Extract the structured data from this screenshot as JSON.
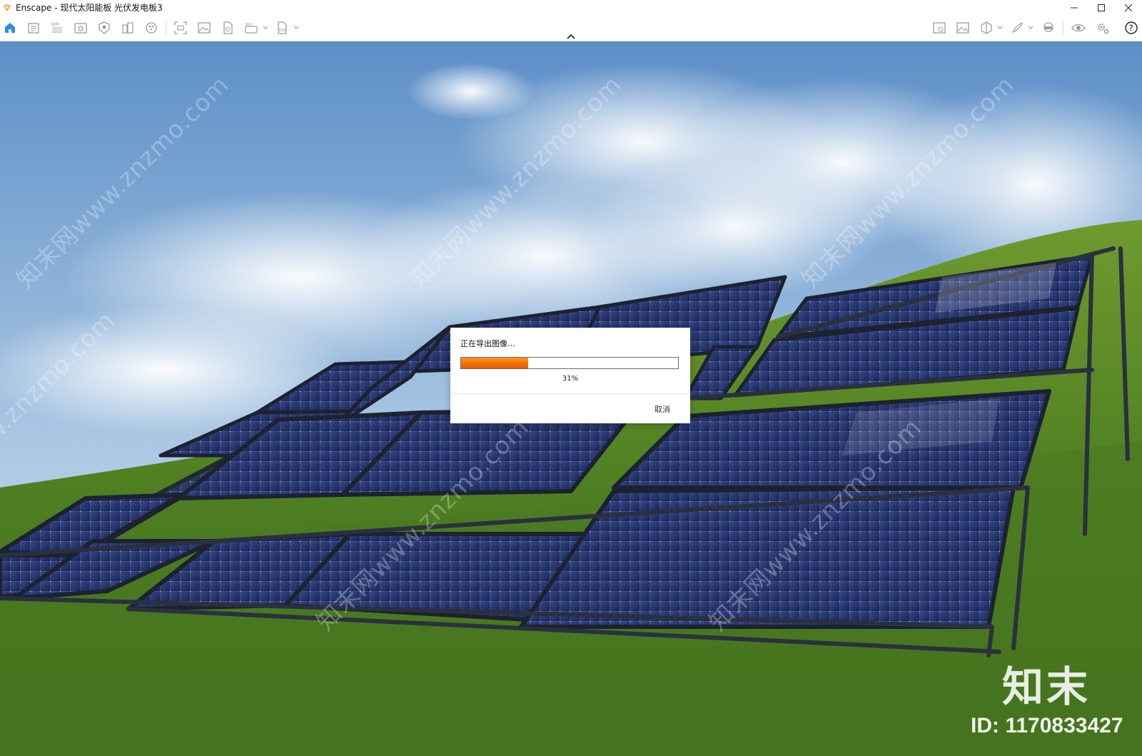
{
  "window": {
    "app_name": "Enscape",
    "title": "Enscape - 现代太阳能板 光伏发电板3",
    "controls": [
      "minimize-icon",
      "maximize-icon",
      "close-icon"
    ]
  },
  "toolbar": {
    "left_icons": [
      "home-icon",
      "document-icon",
      "bim-icon",
      "view-icon",
      "asset-library-icon",
      "buildings-icon",
      "materials-icon",
      "screenshot-icon",
      "image-icon",
      "export-icon",
      "panorama-icon",
      "exe-export-icon"
    ],
    "right_icons": [
      "capture-icon",
      "gallery-icon",
      "cube-icon",
      "brush-icon",
      "vr-headset-icon",
      "eye-icon",
      "settings-icon",
      "help-icon"
    ],
    "collapse_icon": "chevron-up-icon",
    "accent_color": "#3a8ee6"
  },
  "dialog": {
    "title": "正在导出图像…",
    "progress": 0.31,
    "progress_label": "31%",
    "cancel_label": "取消",
    "progress_color": "#f36d00"
  },
  "watermark": {
    "diagonal_text": "知末网www.znzmo.com",
    "brand": "知末",
    "id": "ID: 1170833427"
  }
}
